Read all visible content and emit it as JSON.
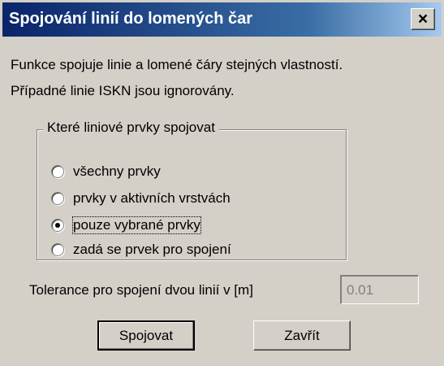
{
  "window": {
    "title": "Spojování linií do lomených čar",
    "close_label": "×"
  },
  "description": {
    "line1": "Funkce spojuje linie a lomené čáry stejných vlastností.",
    "line2": "Případné linie ISKN jsou ignorovány."
  },
  "group": {
    "legend": "Které liniové prvky spojovat",
    "options": [
      {
        "label": "všechny prvky",
        "checked": false
      },
      {
        "label": "prvky v aktivních vrstvách",
        "checked": false
      },
      {
        "label": "pouze vybrané prvky",
        "checked": true
      },
      {
        "label": "zadá se prvek pro spojení",
        "checked": false
      }
    ]
  },
  "tolerance": {
    "label": "Tolerance pro spojení dvou linií v [m]",
    "value": "0.01"
  },
  "buttons": {
    "join_label": "Spojovat",
    "close_label": "Zavřít"
  }
}
